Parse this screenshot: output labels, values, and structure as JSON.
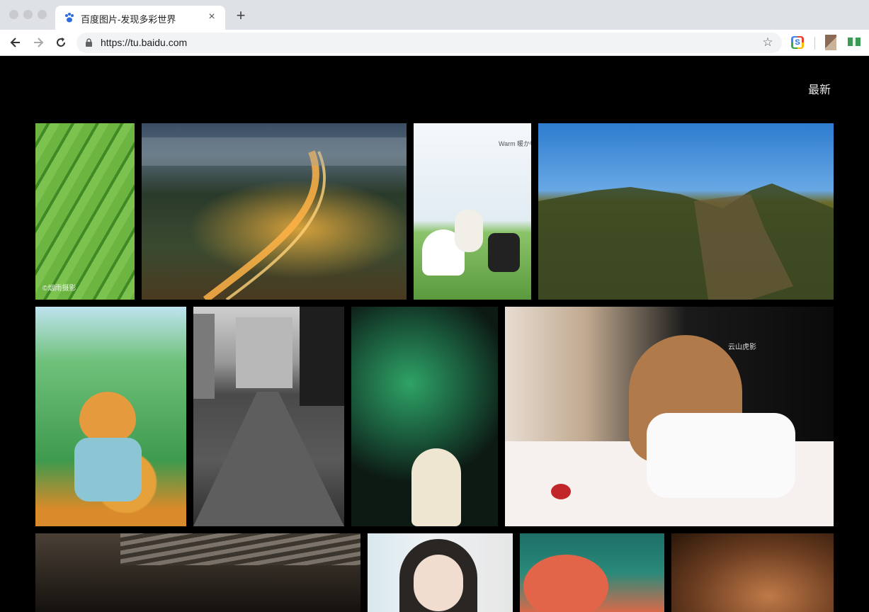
{
  "browser": {
    "tab_title": "百度图片-发现多彩世界",
    "url": "https://tu.baidu.com",
    "new_tab_symbol": "+",
    "close_symbol": "×",
    "star_symbol": "☆"
  },
  "page": {
    "latest_label": "最新"
  },
  "photos": [
    {
      "name": "photo-green-leaf",
      "caption": "©烟雨摄影",
      "colors": [
        "#5faa3a",
        "#2f7a1a"
      ]
    },
    {
      "name": "photo-city-night-highway",
      "caption": "",
      "colors": [
        "#2b3a4a",
        "#c89a3a"
      ]
    },
    {
      "name": "photo-wedding-field",
      "caption": "Warm 暖かい",
      "colors": [
        "#dfeaf2",
        "#6aa84f"
      ]
    },
    {
      "name": "photo-great-wall",
      "caption": "",
      "colors": [
        "#2f7fd1",
        "#4a5a2a"
      ]
    },
    {
      "name": "photo-cat-illustration",
      "caption": "",
      "colors": [
        "#6fc17a",
        "#e8a23a"
      ]
    },
    {
      "name": "photo-bw-city-street",
      "caption": "",
      "colors": [
        "#888888",
        "#2a2a2a"
      ]
    },
    {
      "name": "photo-woman-green-smoke",
      "caption": "",
      "colors": [
        "#1e6b45",
        "#0e1f18"
      ]
    },
    {
      "name": "photo-woman-rose",
      "caption": "云山虎影",
      "colors": [
        "#f2e6dc",
        "#b03030"
      ]
    },
    {
      "name": "photo-crowd-boats",
      "caption": "",
      "colors": [
        "#6a5a4a",
        "#1a1a1a"
      ]
    },
    {
      "name": "photo-girl-portrait",
      "caption": "",
      "colors": [
        "#e9ecef",
        "#3a3a3a"
      ]
    },
    {
      "name": "photo-woman-teal",
      "caption": "",
      "colors": [
        "#2a8a7a",
        "#e0684a"
      ]
    },
    {
      "name": "photo-woman-warm",
      "caption": "",
      "colors": [
        "#a0603a",
        "#3a2010"
      ]
    }
  ]
}
